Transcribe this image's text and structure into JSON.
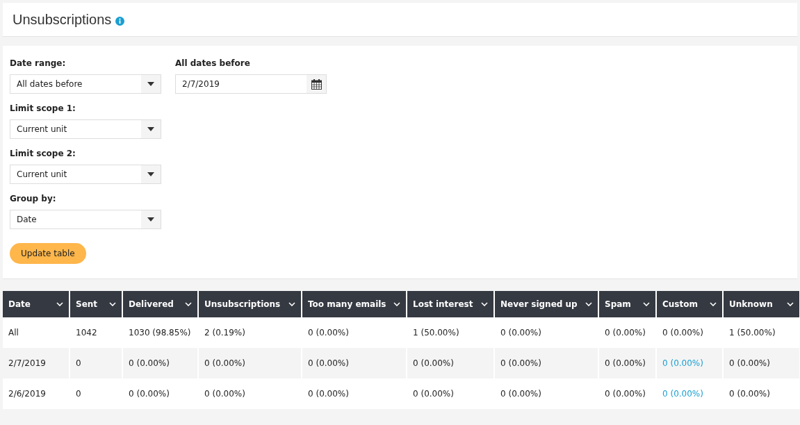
{
  "page": {
    "title": "Unsubscriptions"
  },
  "filters": [
    {
      "label": "Date range:",
      "kind": "select",
      "value": "All dates before"
    },
    {
      "label": "Limit scope 1:",
      "kind": "select",
      "value": "Current unit"
    },
    {
      "label": "Limit scope 2:",
      "kind": "select",
      "value": "Current unit"
    },
    {
      "label": "Group by:",
      "kind": "select",
      "value": "Date"
    }
  ],
  "date_field": {
    "label": "All dates before",
    "value": "2/7/2019"
  },
  "update_button": "Update table",
  "table": {
    "columns": [
      "Date",
      "Sent",
      "Delivered",
      "Unsubscriptions",
      "Too many emails",
      "Lost interest",
      "Never signed up",
      "Spam",
      "Custom",
      "Unknown"
    ],
    "rows": [
      {
        "cells": [
          {
            "text": "All",
            "link": false
          },
          {
            "text": "1042",
            "link": false
          },
          {
            "text": "1030 (98.85%)",
            "link": false
          },
          {
            "text": "2 (0.19%)",
            "link": false
          },
          {
            "text": "0 (0.00%)",
            "link": false
          },
          {
            "text": "1 (50.00%)",
            "link": false
          },
          {
            "text": "0 (0.00%)",
            "link": false
          },
          {
            "text": "0 (0.00%)",
            "link": false
          },
          {
            "text": "0 (0.00%)",
            "link": false
          },
          {
            "text": "1 (50.00%)",
            "link": false
          }
        ]
      },
      {
        "cells": [
          {
            "text": "2/7/2019",
            "link": false
          },
          {
            "text": "0",
            "link": false
          },
          {
            "text": "0 (0.00%)",
            "link": false
          },
          {
            "text": "0 (0.00%)",
            "link": false
          },
          {
            "text": "0 (0.00%)",
            "link": false
          },
          {
            "text": "0 (0.00%)",
            "link": false
          },
          {
            "text": "0 (0.00%)",
            "link": false
          },
          {
            "text": "0 (0.00%)",
            "link": false
          },
          {
            "text": "0 (0.00%)",
            "link": true
          },
          {
            "text": "0 (0.00%)",
            "link": false
          }
        ]
      },
      {
        "cells": [
          {
            "text": "2/6/2019",
            "link": false
          },
          {
            "text": "0",
            "link": false
          },
          {
            "text": "0 (0.00%)",
            "link": false
          },
          {
            "text": "0 (0.00%)",
            "link": false
          },
          {
            "text": "0 (0.00%)",
            "link": false
          },
          {
            "text": "0 (0.00%)",
            "link": false
          },
          {
            "text": "0 (0.00%)",
            "link": false
          },
          {
            "text": "0 (0.00%)",
            "link": false
          },
          {
            "text": "0 (0.00%)",
            "link": true
          },
          {
            "text": "0 (0.00%)",
            "link": false
          }
        ]
      }
    ]
  }
}
